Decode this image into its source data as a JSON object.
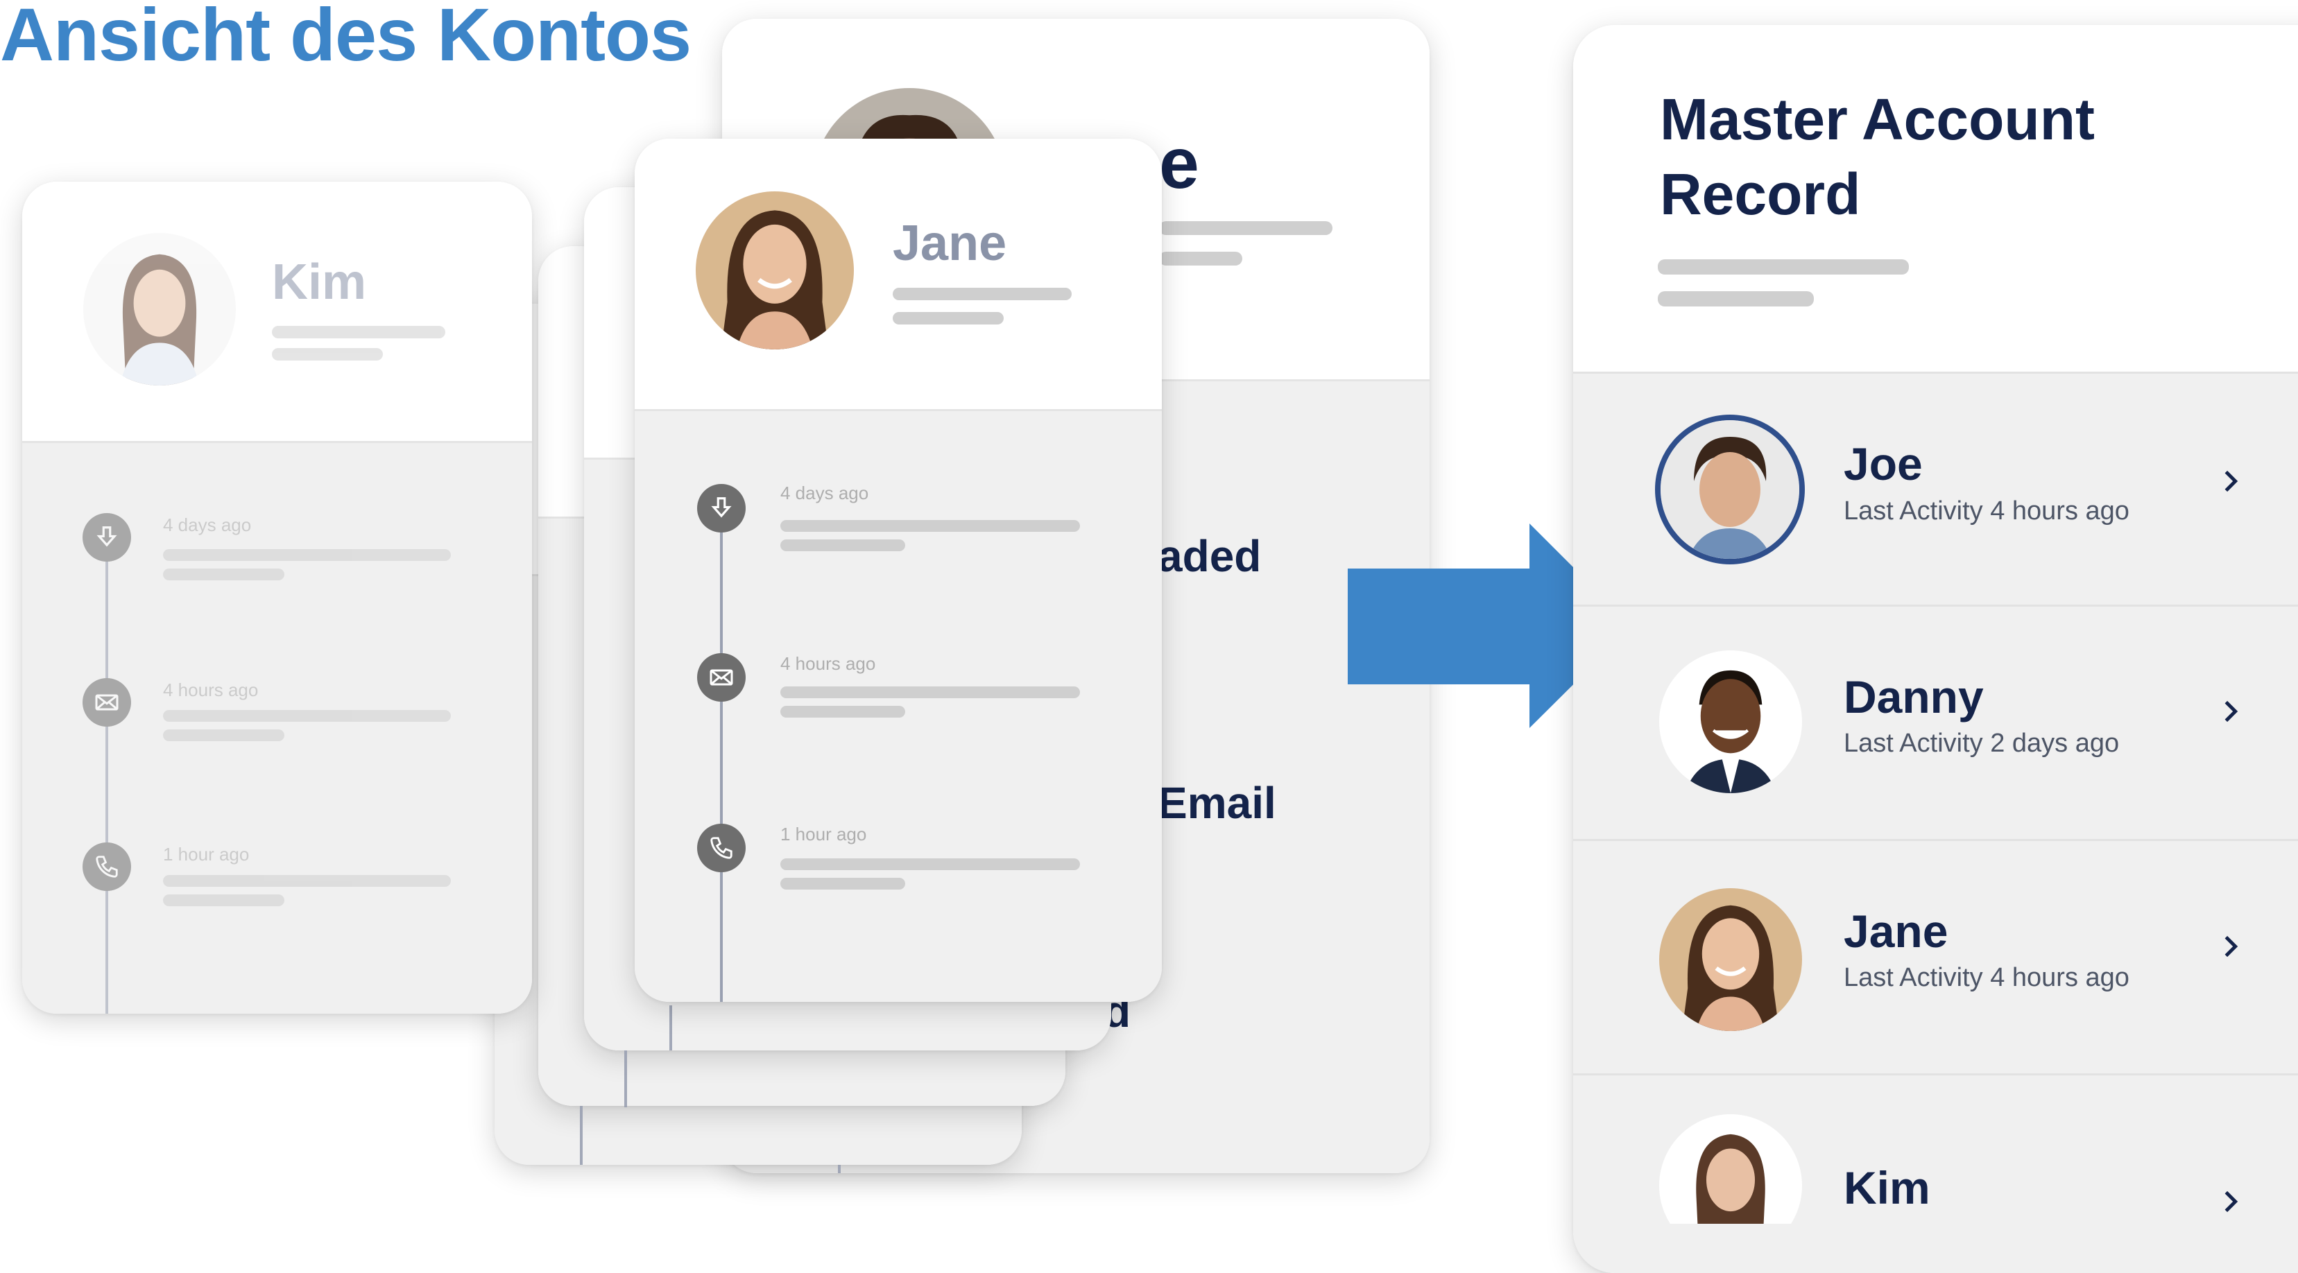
{
  "headline": "Ansicht des Kontos",
  "colors": {
    "accent": "#3d85c8",
    "navy": "#14234a",
    "profile_name": "#8a93a8",
    "timeline_node": "#6e6e6e",
    "panel_gray": "#f0f0f0"
  },
  "joe_card": {
    "name_fragment": "e",
    "activity_fragment_1": "aded",
    "activity_fragment_2": "Email",
    "activity_fragment_3": "d"
  },
  "kim_card": {
    "name": "Kim",
    "timeline": [
      {
        "time": "4 days ago",
        "icon": "download-icon"
      },
      {
        "time": "4 hours ago",
        "icon": "envelope-icon"
      },
      {
        "time": "1 hour ago",
        "icon": "phone-icon"
      }
    ]
  },
  "jane_card": {
    "name": "Jane",
    "timeline": [
      {
        "time": "4 days ago",
        "icon": "download-icon"
      },
      {
        "time": "4 hours ago",
        "icon": "envelope-icon"
      },
      {
        "time": "1 hour ago",
        "icon": "phone-icon"
      }
    ]
  },
  "arrow": {
    "icon": "right-arrow-icon"
  },
  "master": {
    "title_line1": "Master Account",
    "title_line2": "Record",
    "rows": [
      {
        "name": "Joe",
        "activity_label": "Last Activity",
        "activity_time": "4 hours ago",
        "icon": "chevron-right-icon"
      },
      {
        "name": "Danny",
        "activity_label": "Last Activity",
        "activity_time": "2 days ago",
        "icon": "chevron-right-icon"
      },
      {
        "name": "Jane",
        "activity_label": "Last Activity",
        "activity_time": "4 hours ago",
        "icon": "chevron-right-icon"
      },
      {
        "name": "Kim",
        "icon": "chevron-right-icon"
      }
    ]
  }
}
